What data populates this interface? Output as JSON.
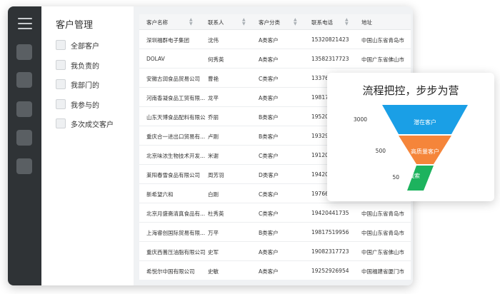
{
  "sidebar": {
    "title": "客户管理",
    "items": [
      {
        "label": "全部客户"
      },
      {
        "label": "我负责的"
      },
      {
        "label": "我部门的"
      },
      {
        "label": "我参与的"
      },
      {
        "label": "多次成交客户"
      }
    ]
  },
  "table": {
    "columns": [
      "客户名称",
      "联系人",
      "客户分类",
      "联系电话",
      "地址"
    ],
    "rows": [
      {
        "name": "深圳福群电子集团",
        "contact": "沈伟",
        "category": "A类客户",
        "phone": "15320821423",
        "address": "中国山东省青岛市"
      },
      {
        "name": "DOLAV",
        "contact": "何秀英",
        "category": "A类客户",
        "phone": "13582317723",
        "address": "中国广东省佛山市"
      },
      {
        "name": "安徽古润食品贸易公司",
        "contact": "曹艳",
        "category": "C类客户",
        "phone": "13376",
        "address": ""
      },
      {
        "name": "河南香凝食品工贸有限...",
        "contact": "龙平",
        "category": "A类客户",
        "phone": "19817",
        "address": ""
      },
      {
        "name": "山东天博食品配料有限公...",
        "contact": "乔丽",
        "category": "B类客户",
        "phone": "19520",
        "address": ""
      },
      {
        "name": "重庆合一进出口贸易有...",
        "contact": "卢刚",
        "category": "B类客户",
        "phone": "19329",
        "address": ""
      },
      {
        "name": "北京味浓生物技术开发...",
        "contact": "米谢",
        "category": "C类客户",
        "phone": "19120",
        "address": ""
      },
      {
        "name": "莱阳春雪食品有限公司",
        "contact": "周芳羽",
        "category": "D类客户",
        "phone": "19420",
        "address": ""
      },
      {
        "name": "新希望六和",
        "contact": "白刚",
        "category": "C类客户",
        "phone": "19766",
        "address": ""
      },
      {
        "name": "北京月盛斋清真食品有...",
        "contact": "杜秀英",
        "category": "C类客户",
        "phone": "19420441735",
        "address": "中国山东省青岛市"
      },
      {
        "name": "上海睿创国际贸易有限...",
        "contact": "万平",
        "category": "B类客户",
        "phone": "19817519956",
        "address": "中国山东省青岛市"
      },
      {
        "name": "重庆西蓍压油脂有限公司",
        "contact": "史军",
        "category": "A类客户",
        "phone": "19082317723",
        "address": "中国广东省佛山市"
      },
      {
        "name": "希悦尔中国有限公司",
        "contact": "史敏",
        "category": "A类客户",
        "phone": "19252926954",
        "address": "中国福建省厦门市"
      }
    ]
  },
  "funnel_card": {
    "title": "流程把控，步步为营",
    "stages": [
      {
        "label": "潜在客户",
        "value": "3000",
        "color": "#1a9fe6"
      },
      {
        "label": "高质量客户",
        "value": "500",
        "color": "#f5853a"
      },
      {
        "label": "线索",
        "value": "50",
        "color": "#1db35e"
      }
    ]
  },
  "colors": {
    "rail": "#2f3336",
    "content_bg": "#f0f2f4"
  }
}
